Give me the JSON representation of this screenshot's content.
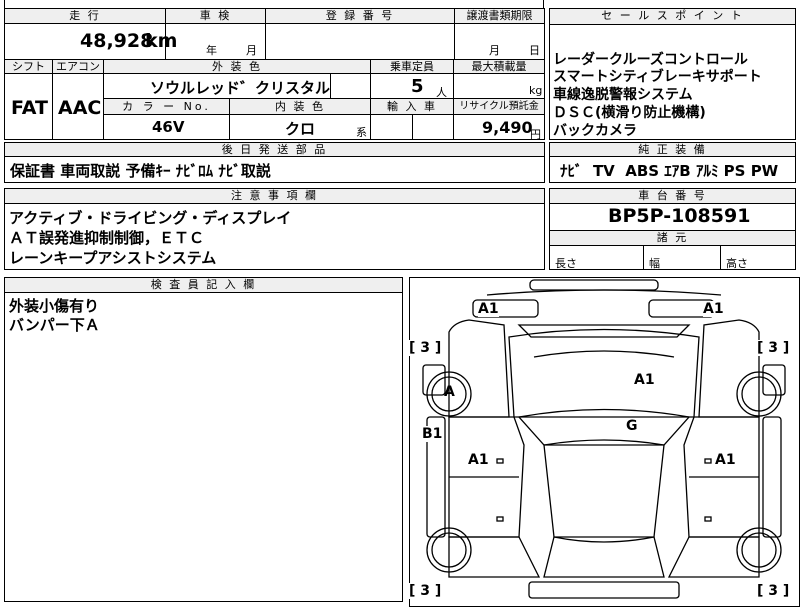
{
  "top": {
    "mileage_label": "走 行",
    "inspection_label": "車 検",
    "registration_label": "登 録 番 号",
    "transfer_label": "譲渡書類期限",
    "mileage_value": "48,928",
    "mileage_unit": "km",
    "year_unit": "年",
    "month_unit": "月",
    "transfer_month_unit": "月",
    "transfer_day_unit": "日"
  },
  "row2": {
    "shift_label": "シフト",
    "ac_label": "エアコン",
    "exterior_label": "外 装 色",
    "capacity_label": "乗車定員",
    "max_load_label": "最大積載量",
    "shift_value": "FAT",
    "ac_value": "AAC",
    "exterior_value": "ソウルレッド゛クリスタル",
    "capacity_value": "5",
    "capacity_unit": "人",
    "max_load_unit": "kg",
    "color_no_label": "カ ラ ー No.",
    "interior_label": "内 装 色",
    "import_label": "輸 入 車",
    "recycle_label": "リサイクル預託金",
    "color_no_value": "46V",
    "interior_value": "クロ",
    "interior_suffix": "系",
    "recycle_value": "9,490",
    "recycle_unit": "円"
  },
  "later_docs": {
    "label": "後 日 発 送 部 品",
    "value": "保証書 車両取説 予備ｷｰ ﾅﾋﾞﾛﾑ ﾅﾋﾞ取説"
  },
  "notes": {
    "label": "注 意 事 項 欄",
    "lines": [
      "アクティブ・ドライビング・ディスプレイ",
      "ＡＴ誤発進抑制制御，ＥＴＣ",
      "レーンキープアシストシステム"
    ]
  },
  "inspector": {
    "label": "検 査 員 記 入 欄",
    "lines": [
      "外装小傷有り",
      "バンパー下Ａ"
    ]
  },
  "sales": {
    "label": "セ ー ル ス ポ イ ン ト",
    "lines": [
      "レーダークルーズコントロール",
      "スマートシティブレーキサポート",
      "車線逸脱警報システム",
      "ＤＳＣ(横滑り防止機構)",
      "バックカメラ"
    ]
  },
  "genuine": {
    "label": "純 正 装 備",
    "value": "ﾅﾋﾞ  TV  ABS ｴｱB ｱﾙﾐ PS PW"
  },
  "chassis": {
    "label": "車 台 番 号",
    "value": "BP5P-108591"
  },
  "specs": {
    "label": "諸 元",
    "length_label": "長さ",
    "width_label": "幅",
    "height_label": "高さ"
  },
  "diagram": {
    "marks": {
      "front_left": "A1",
      "front_right": "A1",
      "tire_fl": "[ 3 ]",
      "tire_fr": "[ 3 ]",
      "fender_left": "A",
      "hood": "A1",
      "rocker_left": "B1",
      "windshield": "G",
      "door_left": "A1",
      "door_right": "A1",
      "tire_rl": "[ 3 ]",
      "tire_rr": "[ 3 ]"
    }
  }
}
